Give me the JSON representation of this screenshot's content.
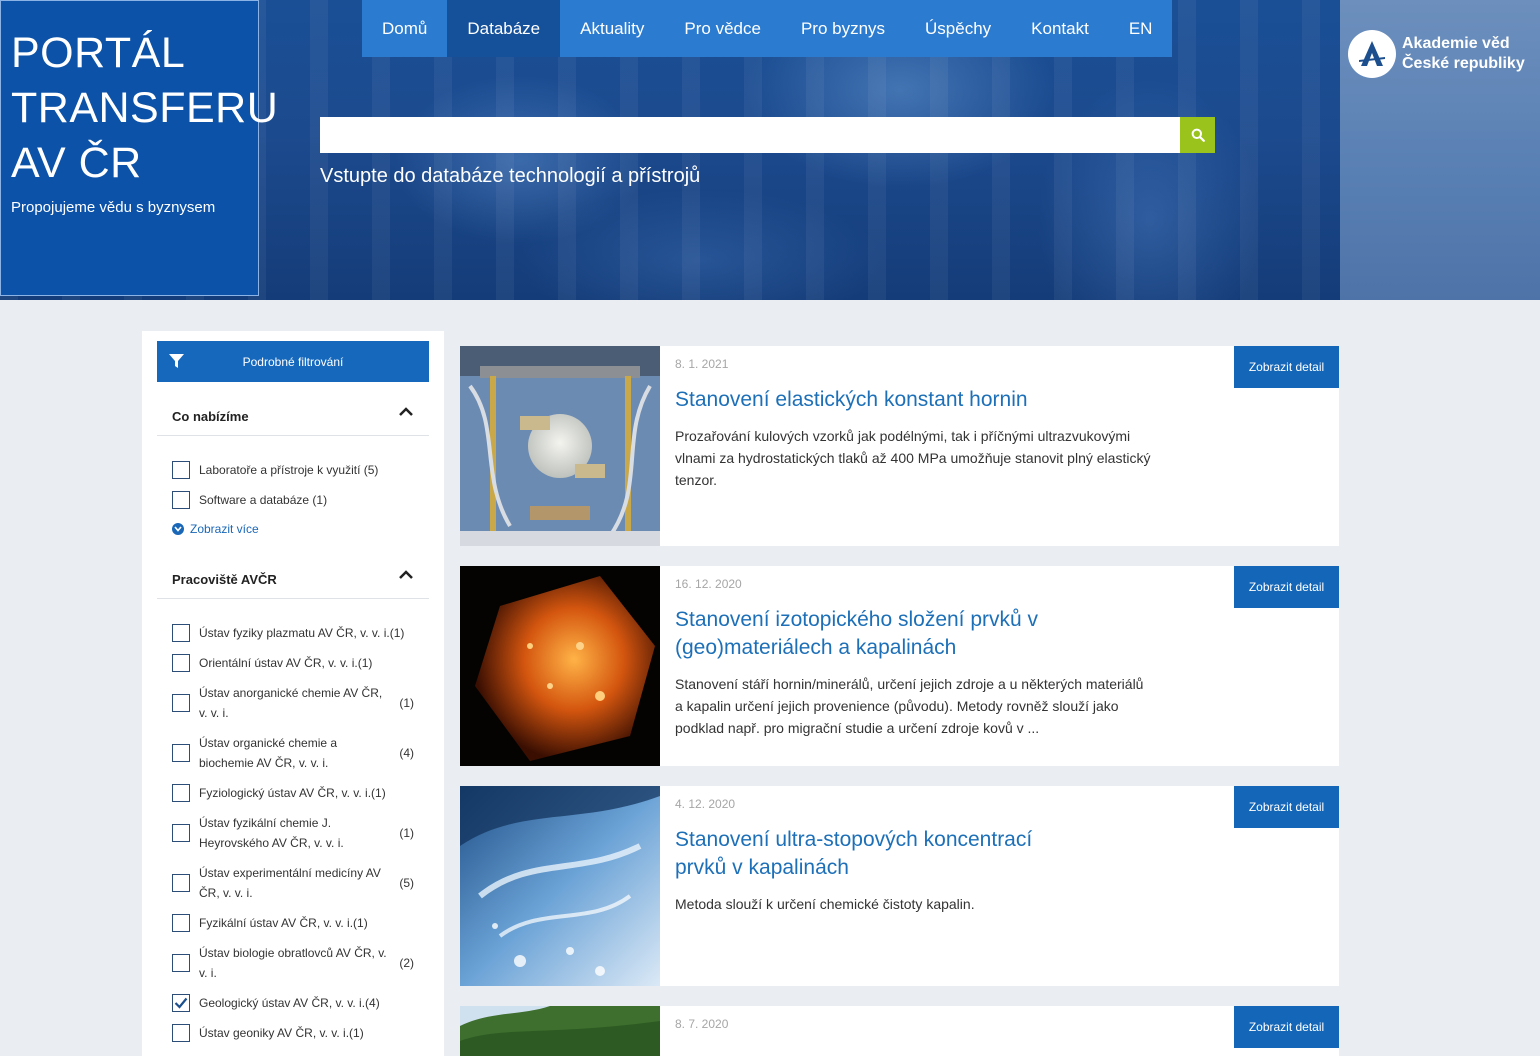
{
  "brand": {
    "title_lines": [
      "PORTÁL",
      "TRANSFERU",
      "AV ČR"
    ],
    "subtitle": "Propojujeme vědu s byznysem"
  },
  "nav": {
    "items": [
      "Domů",
      "Databáze",
      "Aktuality",
      "Pro vědce",
      "Pro byznys",
      "Úspěchy",
      "Kontakt",
      "EN"
    ],
    "active": "Databáze"
  },
  "search": {
    "value": "",
    "caption": "Vstupte do databáze technologií a přístrojů"
  },
  "logo": {
    "line1": "Akademie věd",
    "line2": "České republiky"
  },
  "sidebar": {
    "filter_button": "Podrobné filtrování",
    "sections": [
      {
        "title": "Co nabízíme",
        "items": [
          {
            "label": "Laboratoře a přístroje k využití (5)",
            "checked": false
          },
          {
            "label": "Software a databáze (1)",
            "checked": false
          }
        ],
        "more": "Zobrazit více"
      },
      {
        "title": "Pracoviště AVČR",
        "items": [
          {
            "label": "Ústav fyziky plazmatu AV ČR, v. v. i.(1)",
            "count": "",
            "checked": false
          },
          {
            "label": "Orientální ústav AV ČR, v. v. i.(1)",
            "count": "",
            "checked": false
          },
          {
            "label": "Ústav anorganické chemie AV ČR, v. v. i.",
            "count": "(1)",
            "checked": false
          },
          {
            "label": "Ústav organické chemie a biochemie AV ČR, v. v. i.",
            "count": "(4)",
            "checked": false
          },
          {
            "label": "Fyziologický ústav AV ČR, v. v. i.(1)",
            "count": "",
            "checked": false
          },
          {
            "label": "Ústav fyzikální chemie J. Heyrovského AV ČR, v. v. i.",
            "count": "(1)",
            "checked": false
          },
          {
            "label": "Ústav experimentální medicíny AV ČR, v. v. i.",
            "count": "(5)",
            "checked": false
          },
          {
            "label": "Fyzikální ústav AV ČR, v. v. i.(1)",
            "count": "",
            "checked": false
          },
          {
            "label": "Ústav biologie obratlovců AV ČR, v. v. i.",
            "count": "(2)",
            "checked": false
          },
          {
            "label": "Geologický ústav AV ČR, v. v. i.(4)",
            "count": "",
            "checked": true
          },
          {
            "label": "Ústav geoniky AV ČR, v. v. i.(1)",
            "count": "",
            "checked": false
          }
        ]
      }
    ]
  },
  "results": [
    {
      "date": "8. 1. 2021",
      "title": "Stanovení elastických konstant hornin",
      "description": "Prozařování kulových vzorků jak podélnými, tak i příčnými ultrazvukovými vlnami za hydrostatických tlaků až 400 MPa umožňuje stanovit plný elastický tenzor.",
      "button": "Zobrazit detail"
    },
    {
      "date": "16. 12. 2020",
      "title": "Stanovení izotopického složení prvků v (geo)materiálech a kapalinách",
      "description": "Stanovení stáří hornin/minerálů, určení jejich zdroje a u některých materiálů a kapalin určení jejich provenience (původu). Metody rovněž slouží jako podklad např. pro migrační studie a určení zdroje kovů v ...",
      "button": "Zobrazit detail"
    },
    {
      "date": "4. 12. 2020",
      "title": "Stanovení ultra-stopových koncentrací prvků v kapalinách",
      "description": "Metoda slouží k určení chemické čistoty kapalin.",
      "button": "Zobrazit detail"
    },
    {
      "date": "8. 7. 2020",
      "title": "",
      "description": "",
      "button": "Zobrazit detail"
    }
  ],
  "colors": {
    "nav_bg": "#2b7bd0",
    "nav_active": "#15509a",
    "brand_box": "#0b52a8",
    "accent_button": "#1466b8",
    "search_button": "#9ac31c",
    "link": "#1d70b8"
  },
  "icons": [
    "funnel-icon",
    "search-icon",
    "chevron-up-icon",
    "chevron-down-icon",
    "check-icon",
    "academy-logo-icon"
  ]
}
